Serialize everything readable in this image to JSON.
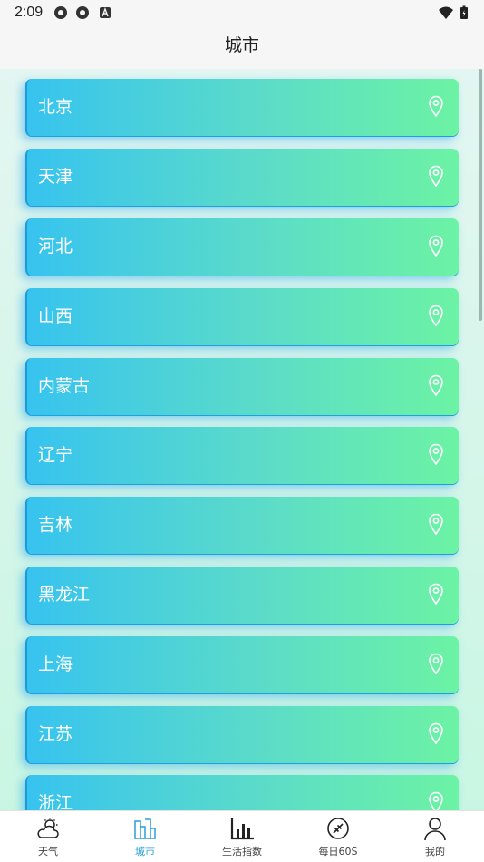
{
  "status": {
    "time": "2:09"
  },
  "header": {
    "title": "城市"
  },
  "cities": [
    "北京",
    "天津",
    "河北",
    "山西",
    "内蒙古",
    "辽宁",
    "吉林",
    "黑龙江",
    "上海",
    "江苏",
    "浙江"
  ],
  "tabs": [
    {
      "label": "天气",
      "icon": "weather-icon"
    },
    {
      "label": "城市",
      "icon": "city-icon",
      "active": true
    },
    {
      "label": "生活指数",
      "icon": "bar-chart-icon"
    },
    {
      "label": "每日60S",
      "icon": "news-icon"
    },
    {
      "label": "我的",
      "icon": "user-icon"
    }
  ],
  "colors": {
    "accent": "#2a9fd6",
    "card_start": "#37c3ef",
    "card_end": "#6cf3a4"
  }
}
